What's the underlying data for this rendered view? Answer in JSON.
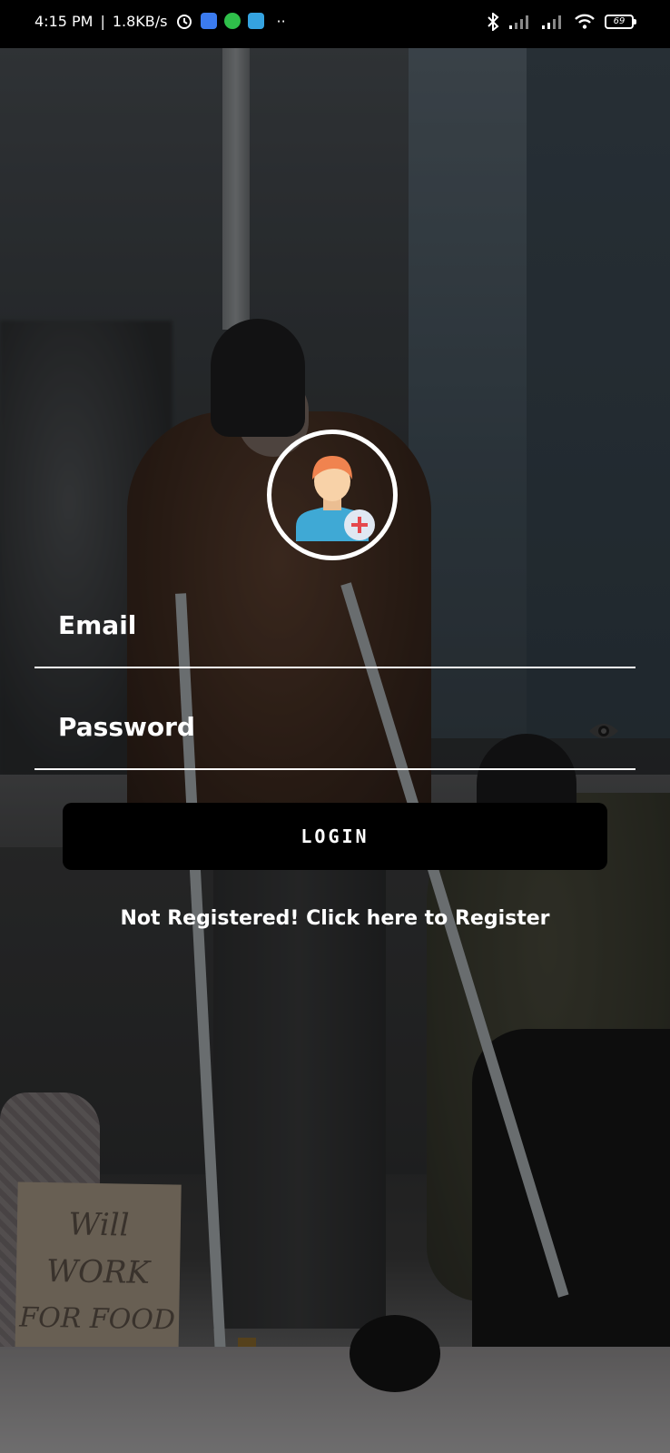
{
  "status_bar": {
    "time": "4:15 PM",
    "network_speed": "1.8KB/s",
    "battery_level": "69",
    "icons": [
      "alarm-icon",
      "messages-app-icon",
      "whatsapp-icon",
      "telegram-icon",
      "more-dots-icon",
      "bluetooth-icon",
      "signal-icon",
      "signal-icon",
      "wifi-icon",
      "battery-icon"
    ]
  },
  "background": {
    "sign_line1": "Will",
    "sign_line2": "WORK",
    "sign_line3": "FOR FOOD"
  },
  "avatar": {
    "icon": "user-add-icon"
  },
  "form": {
    "email_placeholder": "Email",
    "password_placeholder": "Password",
    "password_toggle_icon": "eye-icon",
    "login_label": "LOGIN",
    "register_text": "Not Registered! Click here to Register"
  },
  "colors": {
    "avatar_hair": "#F0834F",
    "avatar_skin": "#F8D2A8",
    "avatar_shirt": "#3FA9D5",
    "plus_badge": "#E0E8F2",
    "plus_sign": "#E5484D",
    "button_bg": "#000000",
    "text": "#FFFFFF"
  }
}
